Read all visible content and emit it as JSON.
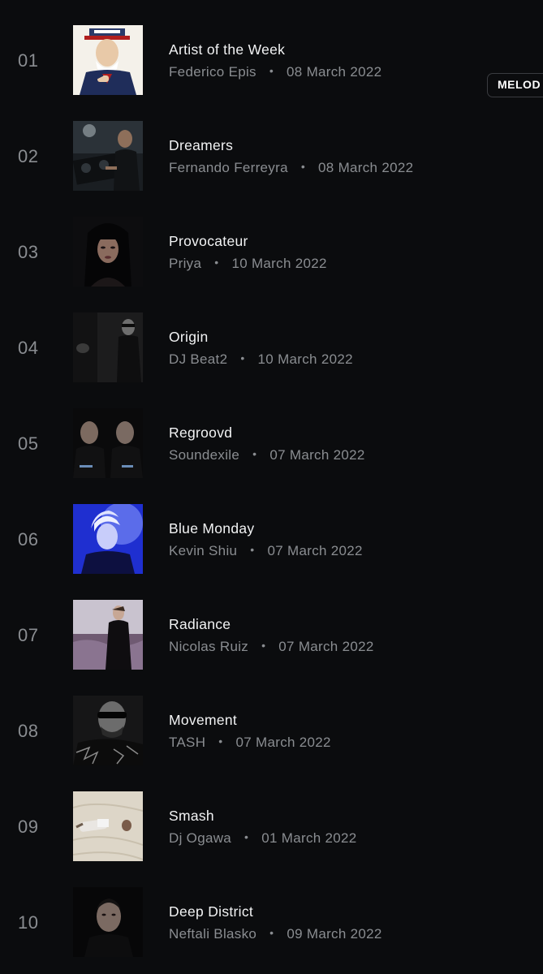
{
  "tracks": [
    {
      "rank": "01",
      "title": "Artist of the Week",
      "artist": "Federico Epis",
      "date": "08 March 2022",
      "art": "uncle-sam-poster-art",
      "tag": "MELOD"
    },
    {
      "rank": "02",
      "title": "Dreamers",
      "artist": "Fernando Ferreyra",
      "date": "08 March 2022",
      "art": "dj-decks-photo"
    },
    {
      "rank": "03",
      "title": "Provocateur",
      "artist": "Priya",
      "date": "10 March 2022",
      "art": "female-portrait-photo"
    },
    {
      "rank": "04",
      "title": "Origin",
      "artist": "DJ Beat2",
      "date": "10 March 2022",
      "art": "dark-portrait-photo"
    },
    {
      "rank": "05",
      "title": "Regroovd",
      "artist": "Soundexile",
      "date": "07 March 2022",
      "art": "duo-portrait-photo"
    },
    {
      "rank": "06",
      "title": "Blue Monday",
      "artist": "Kevin Shiu",
      "date": "07 March 2022",
      "art": "blue-portrait-photo"
    },
    {
      "rank": "07",
      "title": "Radiance",
      "artist": "Nicolas Ruiz",
      "date": "07 March 2022",
      "art": "field-portrait-photo"
    },
    {
      "rank": "08",
      "title": "Movement",
      "artist": "TASH",
      "date": "07 March 2022",
      "art": "sunglasses-portrait-photo"
    },
    {
      "rank": "09",
      "title": "Smash",
      "artist": "Dj Ogawa",
      "date": "01 March 2022",
      "art": "beach-photo"
    },
    {
      "rank": "10",
      "title": "Deep District",
      "artist": "Neftali Blasko",
      "date": "09 March 2022",
      "art": "portrait-photo"
    }
  ],
  "separator": "•",
  "colors": {
    "background": "#0b0c0e",
    "title": "#f2f3f4",
    "muted": "#8a8d91",
    "tag_border": "#3a3c40"
  }
}
